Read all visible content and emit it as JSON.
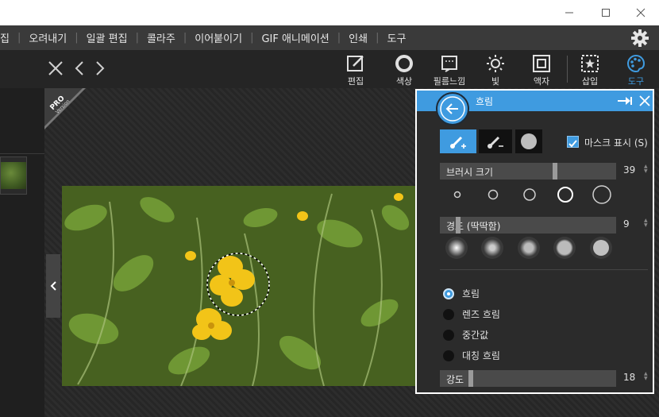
{
  "menu": [
    "집",
    "오려내기",
    "일괄 편집",
    "콜라주",
    "이어붙이기",
    "GIF 애니메이션",
    "인쇄",
    "도구"
  ],
  "toolbar": {
    "tools": [
      {
        "label": "편집",
        "icon": "edit-icon"
      },
      {
        "label": "색상",
        "icon": "color-ring-icon"
      },
      {
        "label": "필름느낌",
        "icon": "film-icon"
      },
      {
        "label": "빛",
        "icon": "sun-icon"
      },
      {
        "label": "액자",
        "icon": "frame-icon"
      },
      {
        "label": "삽입",
        "icon": "insert-star-icon"
      },
      {
        "label": "도구",
        "icon": "palette-icon"
      }
    ]
  },
  "badge": {
    "pro": "PRO",
    "version": "Version"
  },
  "panel": {
    "title": "흐림",
    "mask_label": "마스크 표시 (S)",
    "brush_size_label": "브러시 크기",
    "brush_size_value": "39",
    "hardness_label": "경도 (딱딱함)",
    "hardness_value": "9",
    "radios": [
      "흐림",
      "렌즈 흐림",
      "중간값",
      "대칭 흐림"
    ],
    "selected_radio": "흐림",
    "strength_label": "강도",
    "strength_value": "18"
  },
  "colors": {
    "accent": "#3f9be0",
    "menu_bg": "#3a3a3a",
    "panel_bg": "#2b2b2b"
  }
}
